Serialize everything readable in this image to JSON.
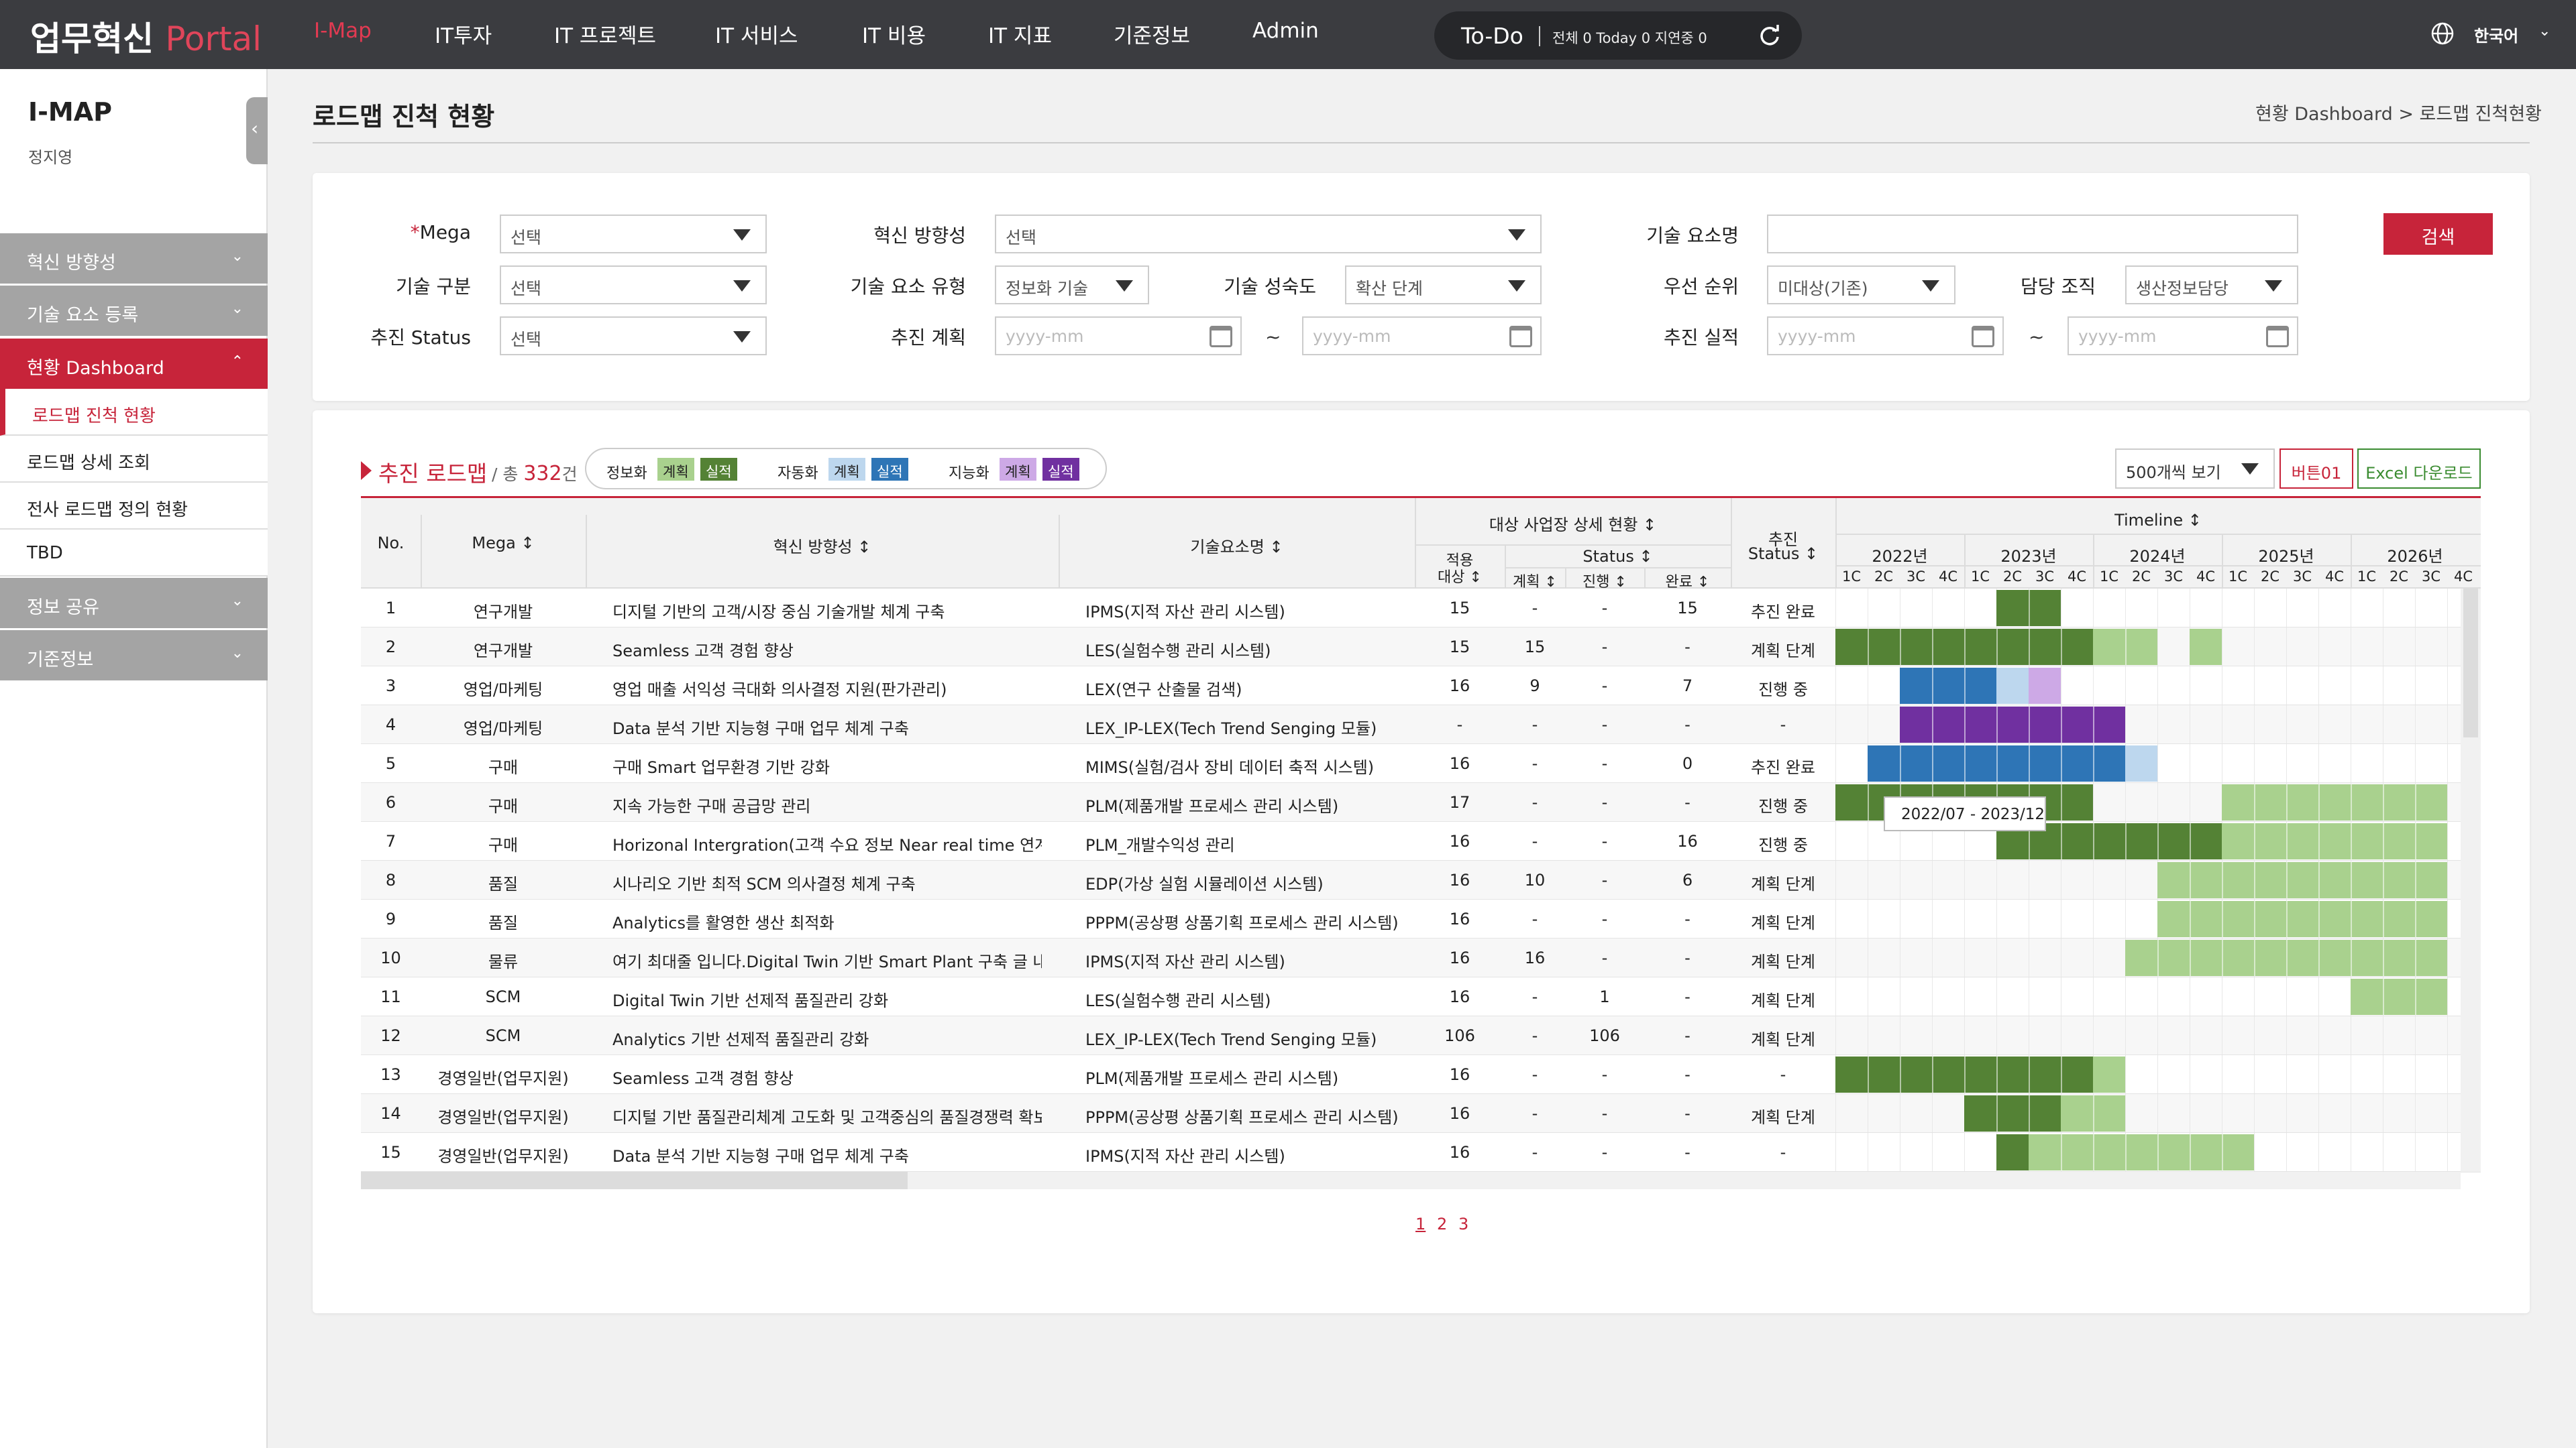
{
  "header": {
    "logo_main": "업무혁신",
    "logo_accent": "Portal",
    "nav": [
      "I-Map",
      "IT투자",
      "IT 프로젝트",
      "IT 서비스",
      "IT 비용",
      "IT 지표",
      "기준정보",
      "Admin"
    ],
    "todo": {
      "label": "To-Do",
      "summary": "전체  0  Today  0  지연중  0"
    },
    "language": "한국어"
  },
  "sidebar": {
    "title": "I-MAP",
    "user": "정지영",
    "items": [
      "혁신 방향성",
      "기술 요소 등록",
      "현황 Dashboard"
    ],
    "sub_items": [
      "로드맵 진척 현황",
      "로드맵 상세 조회",
      "전사 로드맵 정의 현황",
      "TBD"
    ],
    "items_after": [
      "정보 공유",
      "기준정보"
    ]
  },
  "page": {
    "title": "로드맵 진척 현황",
    "breadcrumb": "현황 Dashboard > 로드맵 진척현황"
  },
  "filters": {
    "required_mark": "*",
    "mega_label": "Mega",
    "mega_value": "선택",
    "direction_label": "혁신 방향성",
    "direction_value": "선택",
    "tech_name_label": "기술 요소명",
    "tech_name_value": "",
    "tech_type_label": "기술 구분",
    "tech_type_value": "선택",
    "element_type_label": "기술 요소 유형",
    "element_type_value": "정보화 기술",
    "maturity_label": "기술 성숙도",
    "maturity_value": "확산 단계",
    "priority_label": "우선 순위",
    "priority_value": "미대상(기존)",
    "org_label": "담당 조직",
    "org_value": "생산정보담당",
    "status_label": "추진 Status",
    "status_value": "선택",
    "plan_label": "추진 계획",
    "plan_from": "yyyy-mm",
    "plan_to": "yyyy-mm",
    "actual_label": "추진 실적",
    "actual_from": "yyyy-mm",
    "actual_to": "yyyy-mm",
    "tilde": "~",
    "search": "검색"
  },
  "roadmap": {
    "title": "추진 로드맵",
    "count_prefix": "/ 총",
    "count": "332",
    "count_suffix": "건",
    "legend": [
      {
        "name": "정보화",
        "plan": "계획",
        "actual": "실적",
        "plan_color": "#a9d18e",
        "actual_color": "#548235"
      },
      {
        "name": "자동화",
        "plan": "계획",
        "actual": "실적",
        "plan_color": "#bdd7ee",
        "actual_color": "#2e75b6"
      },
      {
        "name": "지능화",
        "plan": "계획",
        "actual": "실적",
        "plan_color": "#cda9e6",
        "actual_color": "#7030a0"
      }
    ],
    "page_size": "500개씩 보기",
    "button01": "버튼01",
    "excel": "Excel 다운로드"
  },
  "table": {
    "headers": {
      "no": "No.",
      "mega": "Mega ↕",
      "direction": "혁신 방향성 ↕",
      "tech": "기술요소명 ↕",
      "site_group": "대상 사업장 상세 현황 ↕",
      "apply": "적용",
      "apply2": "대상 ↕",
      "status_group": "Status ↕",
      "plan": "계획 ↕",
      "progress": "진행 ↕",
      "done": "완료 ↕",
      "push": "추진",
      "push2": "Status ↕",
      "timeline": "Timeline ↕"
    },
    "years": [
      "2022년",
      "2023년",
      "2024년",
      "2025년",
      "2026년"
    ],
    "quarters": [
      "1C",
      "2C",
      "3C",
      "4C"
    ],
    "rows": [
      {
        "no": "1",
        "mega": "연구개발",
        "direction": "디지털 기반의 고객/시장 중심 기술개발 체계 구축",
        "tech": "IPMS(지적 자산 관리 시스템)",
        "apply": "15",
        "plan": "-",
        "progress": "-",
        "done": "15",
        "status": "추진 완료"
      },
      {
        "no": "2",
        "mega": "연구개발",
        "direction": "Seamless 고객 경험 향상",
        "tech": "LES(실험수행 관리 시스템)",
        "apply": "15",
        "plan": "15",
        "progress": "-",
        "done": "-",
        "status": "계획 단계"
      },
      {
        "no": "3",
        "mega": "영업/마케팅",
        "direction": "영업 매출 서익성 극대화 의사결정 지원(판가관리)",
        "tech": "LEX(연구 산출물 검색)",
        "apply": "16",
        "plan": "9",
        "progress": "-",
        "done": "7",
        "status": "진행 중"
      },
      {
        "no": "4",
        "mega": "영업/마케팅",
        "direction": "Data 분석 기반 지능형 구매 업무 체계 구축",
        "tech": "LEX_IP-LEX(Tech Trend Senging 모듈)",
        "apply": "-",
        "plan": "-",
        "progress": "-",
        "done": "-",
        "status": "-"
      },
      {
        "no": "5",
        "mega": "구매",
        "direction": "구매 Smart 업무환경 기반 강화",
        "tech": "MIMS(실험/검사 장비 데이터 축적 시스템)",
        "apply": "16",
        "plan": "-",
        "progress": "-",
        "done": "0",
        "status": "추진 완료"
      },
      {
        "no": "6",
        "mega": "구매",
        "direction": "지속 가능한 구매 공급망 관리",
        "tech": "PLM(제품개발 프로세스 관리 시스템)",
        "apply": "17",
        "plan": "-",
        "progress": "-",
        "done": "-",
        "status": "진행 중"
      },
      {
        "no": "7",
        "mega": "구매",
        "direction": "Horizonal Intergration(고객 수요 정보 Near real time 연계)",
        "tech": "PLM_개발수익성 관리",
        "apply": "16",
        "plan": "-",
        "progress": "-",
        "done": "16",
        "status": "진행 중"
      },
      {
        "no": "8",
        "mega": "품질",
        "direction": "시나리오 기반 최적 SCM 의사결정 체계 구축",
        "tech": "EDP(가상 실험 시뮬레이션 시스템)",
        "apply": "16",
        "plan": "10",
        "progress": "-",
        "done": "6",
        "status": "계획 단계"
      },
      {
        "no": "9",
        "mega": "품질",
        "direction": "Analytics를 활영한 생산 최적화",
        "tech": "PPPM(공상평 상품기획 프로세스 관리 시스템)",
        "apply": "16",
        "plan": "-",
        "progress": "-",
        "done": "-",
        "status": "계획 단계"
      },
      {
        "no": "10",
        "mega": "물류",
        "direction": "여기 최대줄 입니다.Digital Twin 기반 Smart Plant 구축 글 내용...",
        "tech": "IPMS(지적 자산 관리 시스템)",
        "apply": "16",
        "plan": "16",
        "progress": "-",
        "done": "-",
        "status": "계획 단계"
      },
      {
        "no": "11",
        "mega": "SCM",
        "direction": "Digital Twin 기반  선제적 품질관리 강화",
        "tech": "LES(실험수행 관리 시스템)",
        "apply": "16",
        "plan": "-",
        "progress": "1",
        "done": "-",
        "status": "계획 단계"
      },
      {
        "no": "12",
        "mega": "SCM",
        "direction": "Analytics 기반 선제적 품질관리 강화",
        "tech": "LEX_IP-LEX(Tech Trend Senging 모듈)",
        "apply": "106",
        "plan": "-",
        "progress": "106",
        "done": "-",
        "status": "계획 단계"
      },
      {
        "no": "13",
        "mega": "경영일반(업무지원)",
        "direction": "Seamless 고객 경험 향상",
        "tech": "PLM(제품개발 프로세스 관리 시스템)",
        "apply": "16",
        "plan": "-",
        "progress": "-",
        "done": "-",
        "status": "-"
      },
      {
        "no": "14",
        "mega": "경영일반(업무지원)",
        "direction": "디지털 기반 품질관리체계 고도화 및 고객중심의 품질경쟁력 확보",
        "tech": "PPPM(공상평 상품기획 프로세스 관리 시스템)",
        "apply": "16",
        "plan": "-",
        "progress": "-",
        "done": "-",
        "status": "계획 단계"
      },
      {
        "no": "15",
        "mega": "경영일반(업무지원)",
        "direction": "Data 분석 기반  지능형 구매 업무 체계 구축",
        "tech": "IPMS(지적 자산 관리 시스템)",
        "apply": "16",
        "plan": "-",
        "progress": "-",
        "done": "-",
        "status": "-"
      }
    ],
    "gantt": [
      [
        {
          "from": 5,
          "to": 6,
          "color": "#548235"
        }
      ],
      [
        {
          "from": 0,
          "to": 7,
          "color": "#548235"
        },
        {
          "from": 8,
          "to": 9,
          "color": "#a9d18e"
        },
        {
          "from": 11,
          "to": 11,
          "color": "#a9d18e"
        }
      ],
      [
        {
          "from": 2,
          "to": 4,
          "color": "#2e75b6"
        },
        {
          "from": 5,
          "to": 5,
          "color": "#bdd7ee"
        },
        {
          "from": 6,
          "to": 6,
          "color": "#cda9e6"
        }
      ],
      [
        {
          "from": 2,
          "to": 8,
          "color": "#7030a0"
        }
      ],
      [
        {
          "from": 1,
          "to": 8,
          "color": "#2e75b6"
        },
        {
          "from": 9,
          "to": 9,
          "color": "#bdd7ee"
        }
      ],
      [
        {
          "from": 0,
          "to": 7,
          "color": "#548235"
        },
        {
          "from": 12,
          "to": 18,
          "color": "#a9d18e"
        }
      ],
      [
        {
          "from": 5,
          "to": 11,
          "color": "#548235"
        },
        {
          "from": 12,
          "to": 18,
          "color": "#a9d18e"
        }
      ],
      [
        {
          "from": 10,
          "to": 18,
          "color": "#a9d18e"
        }
      ],
      [
        {
          "from": 10,
          "to": 18,
          "color": "#a9d18e"
        }
      ],
      [
        {
          "from": 9,
          "to": 18,
          "color": "#a9d18e"
        }
      ],
      [
        {
          "from": 16,
          "to": 18,
          "color": "#a9d18e"
        }
      ],
      [],
      [
        {
          "from": 0,
          "to": 7,
          "color": "#548235"
        },
        {
          "from": 8,
          "to": 8,
          "color": "#a9d18e"
        }
      ],
      [
        {
          "from": 4,
          "to": 6,
          "color": "#548235"
        },
        {
          "from": 7,
          "to": 8,
          "color": "#a9d18e"
        }
      ],
      [
        {
          "from": 5,
          "to": 5,
          "color": "#548235"
        },
        {
          "from": 6,
          "to": 12,
          "color": "#a9d18e"
        }
      ]
    ],
    "tooltip": "2022/07 - 2023/12"
  },
  "pagination": [
    "1",
    "2",
    "3"
  ]
}
